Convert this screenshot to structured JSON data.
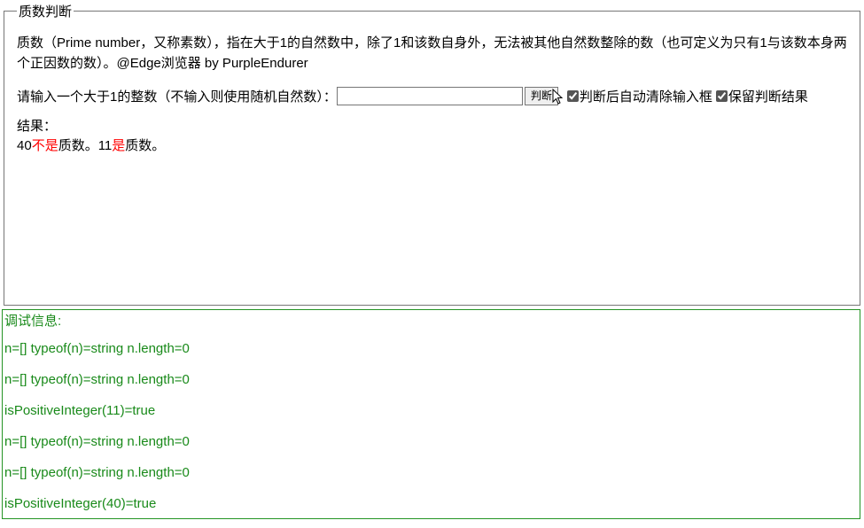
{
  "legend": "质数判断",
  "description": "质数（Prime number，又称素数），指在大于1的自然数中，除了1和该数自身外，无法被其他自然数整除的数（也可定义为只有1与该数本身两个正因数的数）。@Edge浏览器 by PurpleEndurer",
  "input": {
    "prompt": "请输入一个大于1的整数（不输入则使用随机自然数）：",
    "value": "",
    "button": "判断",
    "chk_clear": "判断后自动清除输入框",
    "chk_keep": "保留判断结果"
  },
  "result": {
    "title": "结果：",
    "parts": [
      {
        "t": "40",
        "c": ""
      },
      {
        "t": "不是",
        "c": "red"
      },
      {
        "t": "质数。11",
        "c": ""
      },
      {
        "t": "是",
        "c": "red"
      },
      {
        "t": "质数。",
        "c": ""
      }
    ]
  },
  "debug": {
    "title": "调试信息:",
    "lines": [
      "n=[] typeof(n)=string n.length=0",
      "n=[] typeof(n)=string n.length=0",
      "isPositiveInteger(11)=true",
      "n=[] typeof(n)=string n.length=0",
      "n=[] typeof(n)=string n.length=0",
      "isPositiveInteger(40)=true"
    ]
  }
}
